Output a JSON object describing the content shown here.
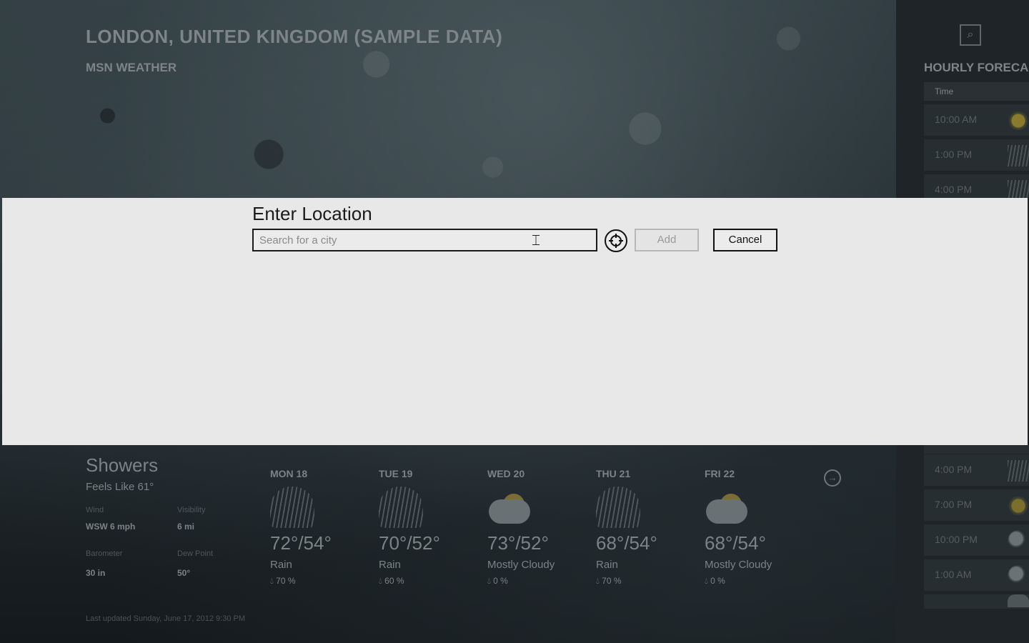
{
  "header": {
    "location_title": "LONDON, UNITED KINGDOM (SAMPLE DATA)",
    "app_name": "MSN WEATHER"
  },
  "hourly": {
    "title": "HOURLY FORECA",
    "column_time": "Time",
    "rows_top": [
      {
        "time": "10:00 AM",
        "icon": "sun-icon"
      },
      {
        "time": "1:00 PM",
        "icon": "rain-icon"
      },
      {
        "time": "4:00 PM",
        "icon": "rain-icon"
      }
    ],
    "rows_bottom": [
      {
        "time": "4:00 PM",
        "icon": "rain-icon"
      },
      {
        "time": "7:00 PM",
        "icon": "sun-icon"
      },
      {
        "time": "10:00 PM",
        "icon": "moon-icon"
      },
      {
        "time": "1:00 AM",
        "icon": "moon-icon"
      }
    ]
  },
  "dialog": {
    "title": "Enter Location",
    "search_placeholder": "Search for a city",
    "add_label": "Add",
    "cancel_label": "Cancel"
  },
  "current": {
    "condition": "Showers",
    "feels_like": "Feels Like 61°",
    "wind_label": "Wind",
    "wind_value": "WSW 6 mph",
    "visibility_label": "Visibility",
    "visibility_value": "6 mi",
    "barometer_label": "Barometer",
    "barometer_value": "30 in",
    "dewpoint_label": "Dew Point",
    "dewpoint_value": "50°"
  },
  "forecast": [
    {
      "day": "MON 18",
      "temp": "72°/54°",
      "condition": "Rain",
      "precip": "70 %",
      "icon": "rain-icon"
    },
    {
      "day": "TUE 19",
      "temp": "70°/52°",
      "condition": "Rain",
      "precip": "60 %",
      "icon": "rain-icon"
    },
    {
      "day": "WED 20",
      "temp": "73°/52°",
      "condition": "Mostly Cloudy",
      "precip": "0 %",
      "icon": "partly-cloudy-icon"
    },
    {
      "day": "THU 21",
      "temp": "68°/54°",
      "condition": "Rain",
      "precip": "70 %",
      "icon": "rain-icon"
    },
    {
      "day": "FRI 22",
      "temp": "68°/54°",
      "condition": "Mostly Cloudy",
      "precip": "0 %",
      "icon": "partly-cloudy-icon"
    }
  ],
  "footer": {
    "last_updated": "Last updated Sunday, June 17, 2012 9:30 PM"
  }
}
